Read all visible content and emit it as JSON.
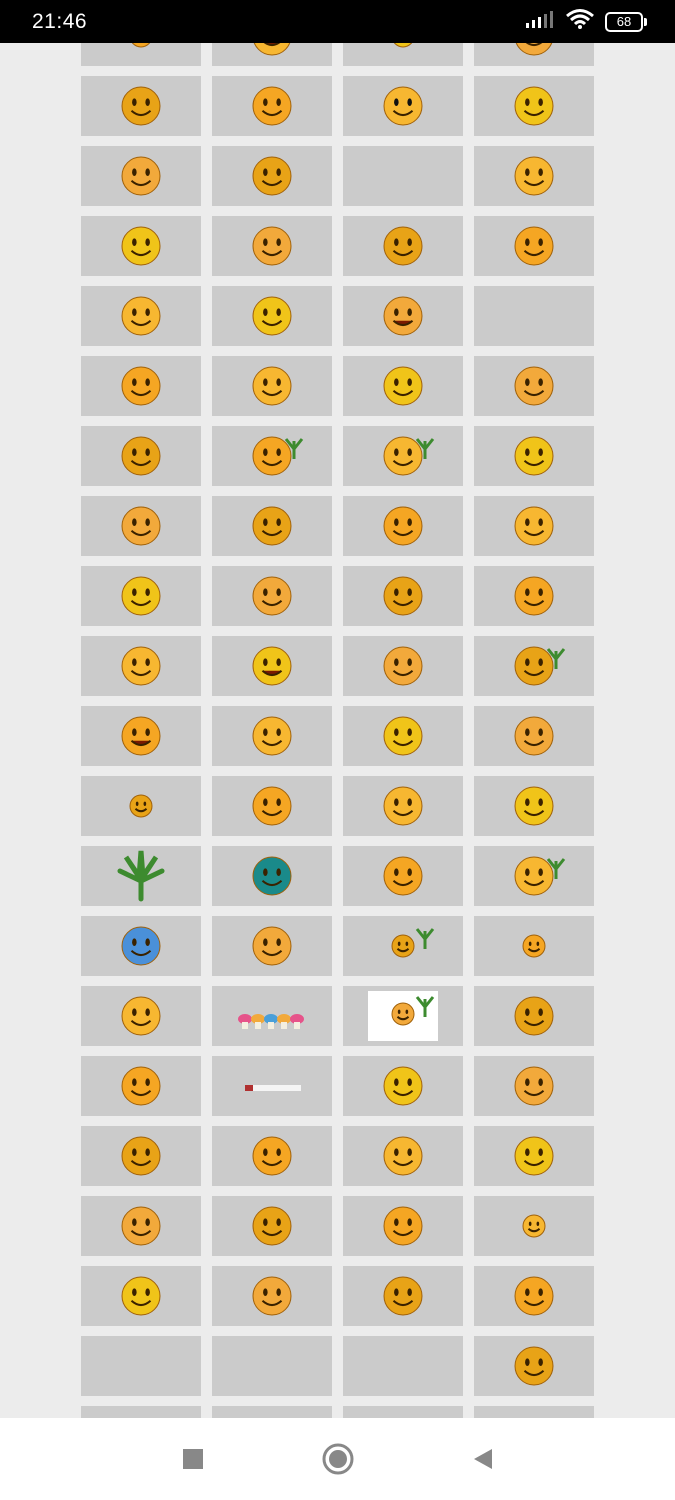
{
  "status_bar": {
    "time": "21:46",
    "battery": "68",
    "icons": [
      "signal-icon",
      "wifi-icon",
      "battery-icon"
    ]
  },
  "grid": {
    "columns": 4,
    "cells": [
      {
        "icon": "smiley-partial-top"
      },
      {
        "icon": "smiley-open-mouth"
      },
      {
        "icon": "smiley-partial-top"
      },
      {
        "icon": "smiley-black-hat"
      },
      {
        "icon": "smiley-clown-party-horn"
      },
      {
        "icon": "smiley-smirk"
      },
      {
        "icon": "smiley-sunglasses"
      },
      {
        "icon": "smiley-reindeer"
      },
      {
        "icon": "smiley-glasses"
      },
      {
        "icon": "smiley-thinking"
      },
      {
        "icon": "empty"
      },
      {
        "icon": "smiley-wizard"
      },
      {
        "icon": "smiley-headphones"
      },
      {
        "icon": "smiley-shifty"
      },
      {
        "icon": "smiley-smoking-pipe"
      },
      {
        "icon": "smiley-big-eyes"
      },
      {
        "icon": "smiley-waving"
      },
      {
        "icon": "smiley-wink"
      },
      {
        "icon": "smiley-grin"
      },
      {
        "icon": "empty"
      },
      {
        "icon": "smiley-clapping"
      },
      {
        "icon": "smiley-rolling-eyes"
      },
      {
        "icon": "smiley-blue-cap-surprised"
      },
      {
        "icon": "smiley-facepalm"
      },
      {
        "icon": "smiley-accordion"
      },
      {
        "icon": "smiley-smoking-leaf"
      },
      {
        "icon": "smiley-potted-plant"
      },
      {
        "icon": "smiley-cupcake"
      },
      {
        "icon": "smiley-pointing-lazy"
      },
      {
        "icon": "smiley-bow-surprised"
      },
      {
        "icon": "smiley-shrug-happy"
      },
      {
        "icon": "smiley-drumming"
      },
      {
        "icon": "smiley-guitar"
      },
      {
        "icon": "smiley-mushroom-girl"
      },
      {
        "icon": "smiley-with-rake"
      },
      {
        "icon": "smiley-lying-laughing"
      },
      {
        "icon": "smiley-moose-antlers"
      },
      {
        "icon": "smiley-big-grin"
      },
      {
        "icon": "smiley-hiding-bush"
      },
      {
        "icon": "smiley-leaf-umbrella"
      },
      {
        "icon": "smiley-bomb-grin"
      },
      {
        "icon": "smiley-moose-head"
      },
      {
        "icon": "smiley-reindeer-santa"
      },
      {
        "icon": "smiley-cow"
      },
      {
        "icon": "smiley-tiny-smoking"
      },
      {
        "icon": "smiley-old-man-cane"
      },
      {
        "icon": "smiley-green-hat"
      },
      {
        "icon": "smiley-sign-board"
      },
      {
        "icon": "cannabis-leaf"
      },
      {
        "icon": "pacman-teal"
      },
      {
        "icon": "smiley-rasta-smoking"
      },
      {
        "icon": "smiley-heart-plant"
      },
      {
        "icon": "smiley-blue-sad"
      },
      {
        "icon": "smiley-fish-barbell"
      },
      {
        "icon": "smiley-pot-plant-small"
      },
      {
        "icon": "smiley-tiny-yellow"
      },
      {
        "icon": "smiley-smoking-pair"
      },
      {
        "icon": "mushrooms-row"
      },
      {
        "icon": "smiley-leaf-white-box"
      },
      {
        "icon": "smiley-mushroom-brown"
      },
      {
        "icon": "smiley-hat-thumbs"
      },
      {
        "icon": "joint-smoke"
      },
      {
        "icon": "smiley-cyclops"
      },
      {
        "icon": "smiley-hugging-pair"
      },
      {
        "icon": "smiley-rolling-joint"
      },
      {
        "icon": "smiley-pink-bows"
      },
      {
        "icon": "smiley-newspaper"
      },
      {
        "icon": "smiley-tongue-out"
      },
      {
        "icon": "smiley-two-twins"
      },
      {
        "icon": "smiley-leaves-glasses"
      },
      {
        "icon": "smiley-hookah"
      },
      {
        "icon": "smiley-small-cheeky"
      },
      {
        "icon": "smiley-joints-chain"
      },
      {
        "icon": "smiley-candy"
      },
      {
        "icon": "smiley-crying-tissue"
      },
      {
        "icon": "smiley-fork-knife"
      },
      {
        "icon": "empty"
      },
      {
        "icon": "empty"
      },
      {
        "icon": "empty"
      },
      {
        "icon": "smiley-magnifier"
      },
      {
        "icon": "empty"
      },
      {
        "icon": "empty"
      },
      {
        "icon": "empty"
      },
      {
        "icon": "empty"
      }
    ]
  },
  "nav_bar": {
    "buttons": [
      "recents-button",
      "home-button",
      "back-button"
    ]
  }
}
